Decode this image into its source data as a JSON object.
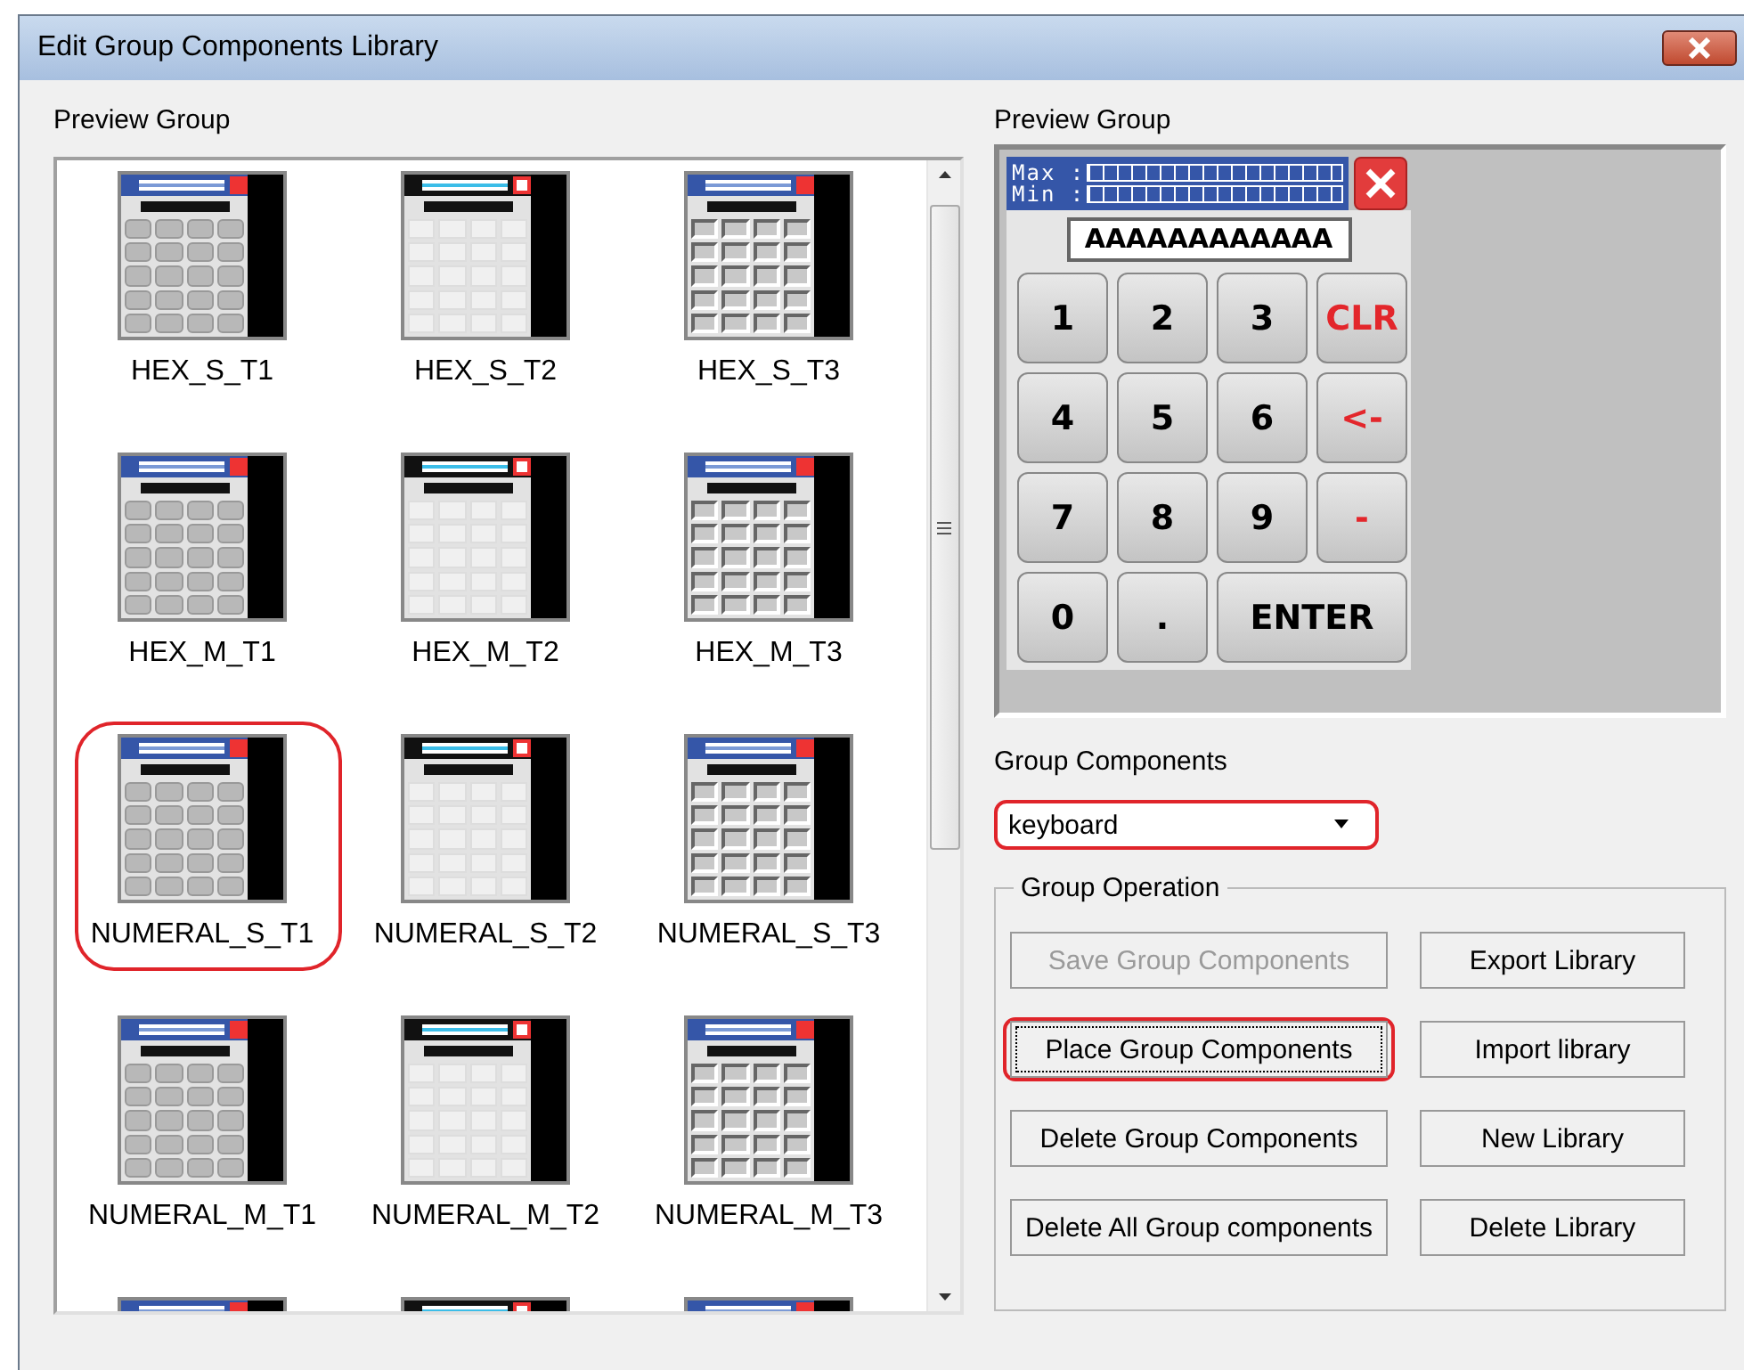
{
  "window": {
    "title": "Edit Group Components Library"
  },
  "library_panel": {
    "label": "Preview Group",
    "thumbnails": [
      {
        "label": "HEX_S_T1",
        "kind": "t1",
        "highlighted": false
      },
      {
        "label": "HEX_S_T2",
        "kind": "t2",
        "highlighted": false
      },
      {
        "label": "HEX_S_T3",
        "kind": "t3",
        "highlighted": false
      },
      {
        "label": "HEX_M_T1",
        "kind": "t1",
        "highlighted": false
      },
      {
        "label": "HEX_M_T2",
        "kind": "t2",
        "highlighted": false
      },
      {
        "label": "HEX_M_T3",
        "kind": "t3",
        "highlighted": false
      },
      {
        "label": "NUMERAL_S_T1",
        "kind": "t1",
        "highlighted": true
      },
      {
        "label": "NUMERAL_S_T2",
        "kind": "t2",
        "highlighted": false
      },
      {
        "label": "NUMERAL_S_T3",
        "kind": "t3",
        "highlighted": false
      },
      {
        "label": "NUMERAL_M_T1",
        "kind": "t1",
        "highlighted": false
      },
      {
        "label": "NUMERAL_M_T2",
        "kind": "t2",
        "highlighted": false
      },
      {
        "label": "NUMERAL_M_T3",
        "kind": "t3",
        "highlighted": false
      },
      {
        "kind": "t1",
        "highlighted": false
      },
      {
        "kind": "t2",
        "highlighted": false
      },
      {
        "kind": "t3",
        "highlighted": false
      }
    ]
  },
  "preview_panel": {
    "label": "Preview Group",
    "keypad": {
      "max_label": "Max :",
      "min_label": "Min :",
      "display": "AAAAAAAAAAAA",
      "keys": [
        {
          "label": "1",
          "kind": "digit"
        },
        {
          "label": "2",
          "kind": "digit"
        },
        {
          "label": "3",
          "kind": "digit"
        },
        {
          "label": "CLR",
          "kind": "command"
        },
        {
          "label": "4",
          "kind": "digit"
        },
        {
          "label": "5",
          "kind": "digit"
        },
        {
          "label": "6",
          "kind": "digit"
        },
        {
          "label": "<-",
          "kind": "command"
        },
        {
          "label": "7",
          "kind": "digit"
        },
        {
          "label": "8",
          "kind": "digit"
        },
        {
          "label": "9",
          "kind": "digit"
        },
        {
          "label": "-",
          "kind": "command"
        },
        {
          "label": "0",
          "kind": "digit"
        },
        {
          "label": ".",
          "kind": "digit"
        },
        {
          "label": "ENTER",
          "kind": "enter"
        }
      ]
    }
  },
  "group_components": {
    "label": "Group Components",
    "value": "keyboard",
    "highlighted": true
  },
  "group_operation": {
    "label": "Group Operation",
    "buttons": [
      {
        "label": "Save Group Components",
        "disabled": true,
        "focused": false,
        "highlighted": false
      },
      {
        "label": "Export Library",
        "disabled": false,
        "focused": false,
        "highlighted": false
      },
      {
        "label": "Place Group Components",
        "disabled": false,
        "focused": true,
        "highlighted": true
      },
      {
        "label": "Import library",
        "disabled": false,
        "focused": false,
        "highlighted": false
      },
      {
        "label": "Delete Group Components",
        "disabled": false,
        "focused": false,
        "highlighted": false
      },
      {
        "label": "New Library",
        "disabled": false,
        "focused": false,
        "highlighted": false
      },
      {
        "label": "Delete All Group components",
        "disabled": false,
        "focused": false,
        "highlighted": false
      },
      {
        "label": "Delete Library",
        "disabled": false,
        "focused": false,
        "highlighted": false
      }
    ]
  }
}
